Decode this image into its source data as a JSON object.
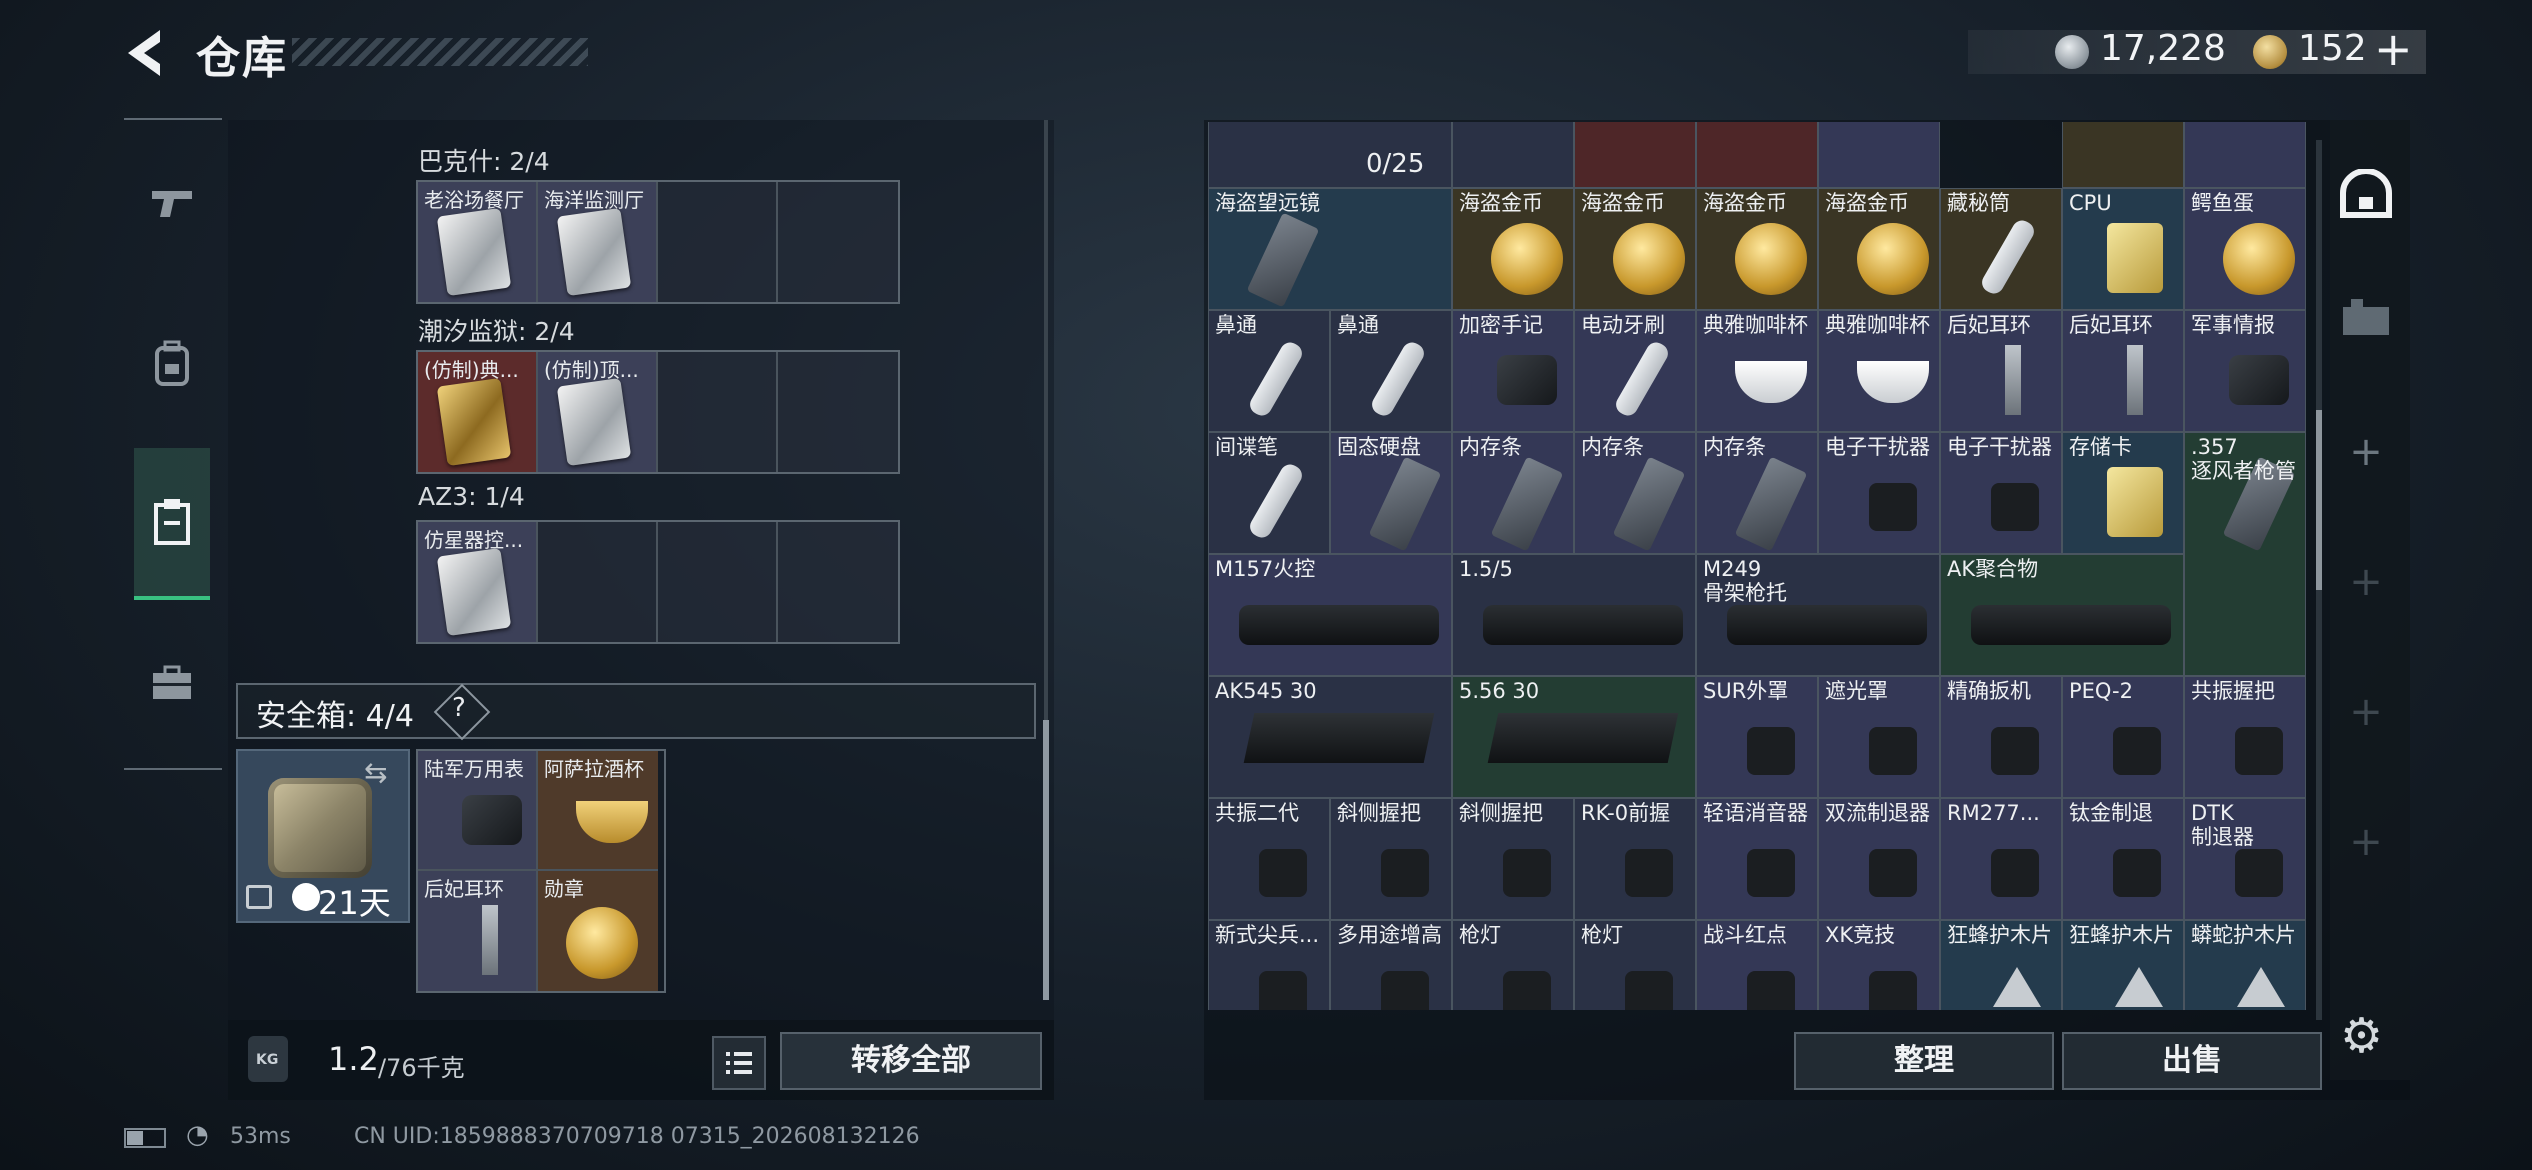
{
  "header": {
    "title": "仓库",
    "currency_silver": "17,228",
    "currency_gold": "152",
    "add_symbol": "+"
  },
  "left": {
    "sections": [
      {
        "title": "巴克什: 2/4",
        "slots": [
          "老浴场餐厅",
          "海洋监测厅",
          "",
          ""
        ]
      },
      {
        "title": "潮汐监狱: 2/4",
        "slots": [
          "(仿制)典...",
          "(仿制)顶...",
          "",
          ""
        ]
      },
      {
        "title": "AZ3: 1/4",
        "slots": [
          "仿星器控...",
          "",
          "",
          ""
        ]
      }
    ],
    "safe_box": {
      "label": "安全箱: 4/4",
      "help": "?",
      "timer": "21天",
      "items": [
        "陆军万用表",
        "阿萨拉酒杯",
        "后妃耳环",
        "勋章"
      ]
    },
    "weight": {
      "value": "1.2",
      "capacity": "/76千克",
      "kg_label": "KG"
    },
    "transfer_label": "转移全部"
  },
  "inventory": {
    "counter": "0/25",
    "cells": [
      "海盗望远镜",
      "海盗金币",
      "海盗金币",
      "海盗金币",
      "海盗金币",
      "藏秘筒",
      "CPU",
      "鳄鱼蛋",
      "鼻通",
      "鼻通",
      "加密手记",
      "电动牙刷",
      "典雅咖啡杯",
      "典雅咖啡杯",
      "后妃耳环",
      "后妃耳环",
      "军事情报",
      "间谍笔",
      "固态硬盘",
      "内存条",
      "内存条",
      "内存条",
      "电子干扰器",
      "电子干扰器",
      "存储卡",
      ".357\n逐风者枪管",
      "M157火控",
      "1.5/5",
      "M249\n骨架枪托",
      "AK聚合物",
      "AK545 30",
      "5.56 30",
      "SUR外罩",
      "遮光罩",
      "精确扳机",
      "PEQ-2",
      "共振握把",
      "共振二代",
      "斜侧握把",
      "斜侧握把",
      "RK-0前握",
      "轻语消音器",
      "双流制退器",
      "RM277...",
      "钛金制退",
      "DTK\n制退器",
      "新式尖兵...",
      "多用途增高",
      "枪灯",
      "枪灯",
      "战斗红点",
      "XK竞技",
      "狂蜂护木片",
      "狂蜂护木片",
      "蟒蛇护木片"
    ],
    "tidy_label": "整理",
    "sell_label": "出售"
  },
  "status": {
    "ping": "53ms",
    "uid": "CN UID:1859888370709718 07315_202608132126"
  }
}
